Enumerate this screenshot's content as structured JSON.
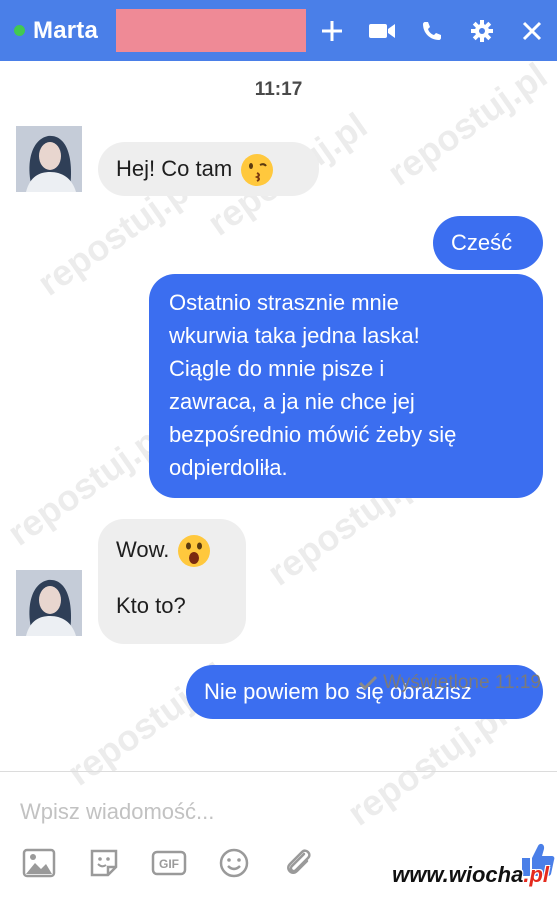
{
  "header": {
    "contact_name": "Marta",
    "online_color": "#42c94f",
    "icons": [
      "plus-icon",
      "video-call-icon",
      "phone-icon",
      "gear-icon",
      "close-icon"
    ]
  },
  "chat": {
    "timestamp": "11:17",
    "messages": [
      {
        "direction": "incoming",
        "text": "Hej! Co tam",
        "emoji": "kissing-emoji"
      },
      {
        "direction": "outgoing",
        "text": "Cześć"
      },
      {
        "direction": "outgoing",
        "lines": [
          "Ostatnio strasznie mnie",
          "wkurwia taka jedna laska!",
          "Ciągle do mnie pisze i",
          "zawraca, a ja nie chce jej",
          "bezpośrednio mówić żeby się",
          "odpierdoliła."
        ]
      },
      {
        "direction": "incoming",
        "text": "Wow.",
        "emoji": "surprised-emoji"
      },
      {
        "direction": "incoming",
        "text": "Kto to?"
      },
      {
        "direction": "outgoing",
        "text": "Nie powiem bo się obrazisz"
      }
    ],
    "seen_status": "Wyświetlone 11:19"
  },
  "composer": {
    "placeholder": "Wpisz wiadomość...",
    "tools": [
      "image-icon",
      "sticker-icon",
      "gif-icon",
      "emoji-icon",
      "attachment-icon",
      "like-icon"
    ]
  },
  "watermark": {
    "text": "repostuj.pl",
    "site_prefix": "www.wiocha",
    "site_suffix": ".pl"
  },
  "colors": {
    "header": "#4a7fe8",
    "outgoing_bubble": "#3b6ef0",
    "incoming_bubble": "#eeeeee"
  }
}
